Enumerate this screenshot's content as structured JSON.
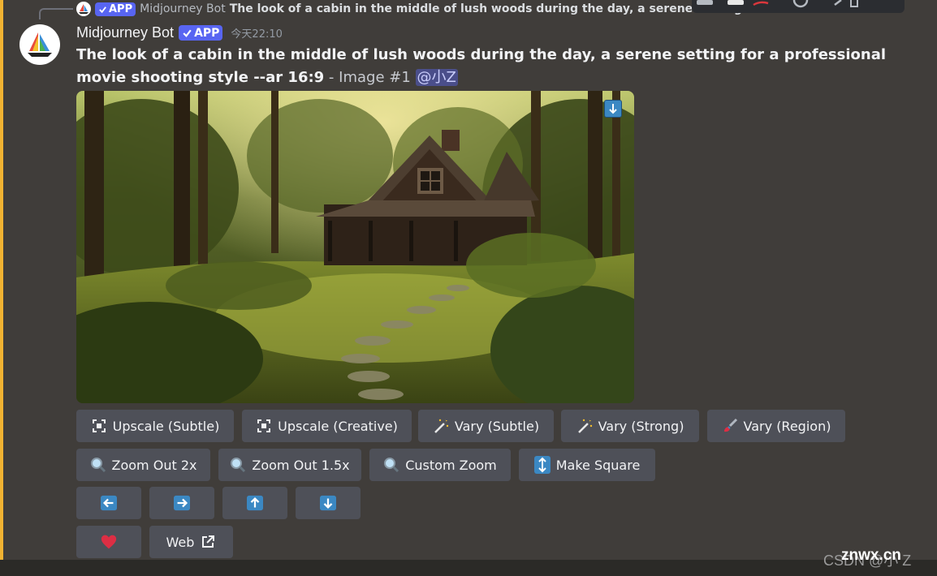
{
  "reply": {
    "badge": "APP",
    "author": "Midjourney Bot",
    "text": "The look of a cabin in the middle of lush woods during the day, a serene setting"
  },
  "message": {
    "author": "Midjourney Bot",
    "badge": "APP",
    "timestamp": "今天22:10",
    "prompt": "The look of a cabin in the middle of lush woods during the day, a serene setting for a professional movie shooting style --ar 16:9",
    "image_label": " - Image #1 ",
    "mention": "@小Z"
  },
  "buttons": {
    "upscale_subtle": "Upscale (Subtle)",
    "upscale_creative": "Upscale (Creative)",
    "vary_subtle": "Vary (Subtle)",
    "vary_strong": "Vary (Strong)",
    "vary_region": "Vary (Region)",
    "zoom_out_2x": "Zoom Out 2x",
    "zoom_out_1_5x": "Zoom Out 1.5x",
    "custom_zoom": "Custom Zoom",
    "make_square": "Make Square",
    "web": "Web"
  },
  "icons": {
    "upscale": "expand-arrows-icon",
    "vary": "magic-wand-icon",
    "region": "paintbrush-icon",
    "zoom": "magnifier-icon",
    "square": "up-down-arrow-icon",
    "pan_left": "arrow-left-icon",
    "pan_right": "arrow-right-icon",
    "pan_up": "arrow-up-icon",
    "pan_down": "arrow-down-icon",
    "favorite": "heart-icon",
    "external": "external-link-icon"
  },
  "colors": {
    "accent": "#f0b232",
    "badge": "#5865f2",
    "button": "#4e5058",
    "emoji_blue": "#3b88c3",
    "heart": "#dd2e44"
  },
  "watermark": {
    "csdn": "CSDN @小 Z",
    "znwx": "znwx.cn"
  }
}
